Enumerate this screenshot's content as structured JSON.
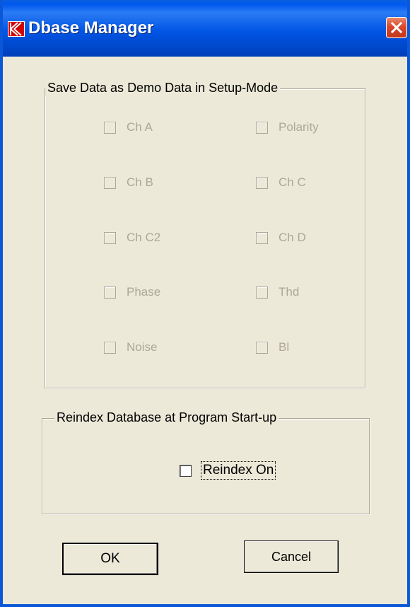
{
  "window": {
    "title": "Dbase Manager",
    "app_icon": "k-logo-icon",
    "close_icon": "close-icon",
    "accent": "#0a57d8",
    "close_color": "#d9492a"
  },
  "demo_group": {
    "legend": "Save Data as Demo Data in Setup-Mode",
    "enabled": false,
    "items": [
      {
        "label": "Ch A",
        "checked": false
      },
      {
        "label": "Polarity",
        "checked": false
      },
      {
        "label": "Ch B",
        "checked": false
      },
      {
        "label": "Ch C",
        "checked": false
      },
      {
        "label": "Ch C2",
        "checked": false
      },
      {
        "label": "Ch D",
        "checked": false
      },
      {
        "label": "Phase",
        "checked": false
      },
      {
        "label": "Thd",
        "checked": false
      },
      {
        "label": "Noise",
        "checked": false
      },
      {
        "label": "Bl",
        "checked": false
      }
    ]
  },
  "reindex_group": {
    "legend": "Reindex Database at Program Start-up",
    "checkbox_label": "Reindex On",
    "checked": false
  },
  "buttons": {
    "ok_label": "OK",
    "cancel_label": "Cancel"
  }
}
